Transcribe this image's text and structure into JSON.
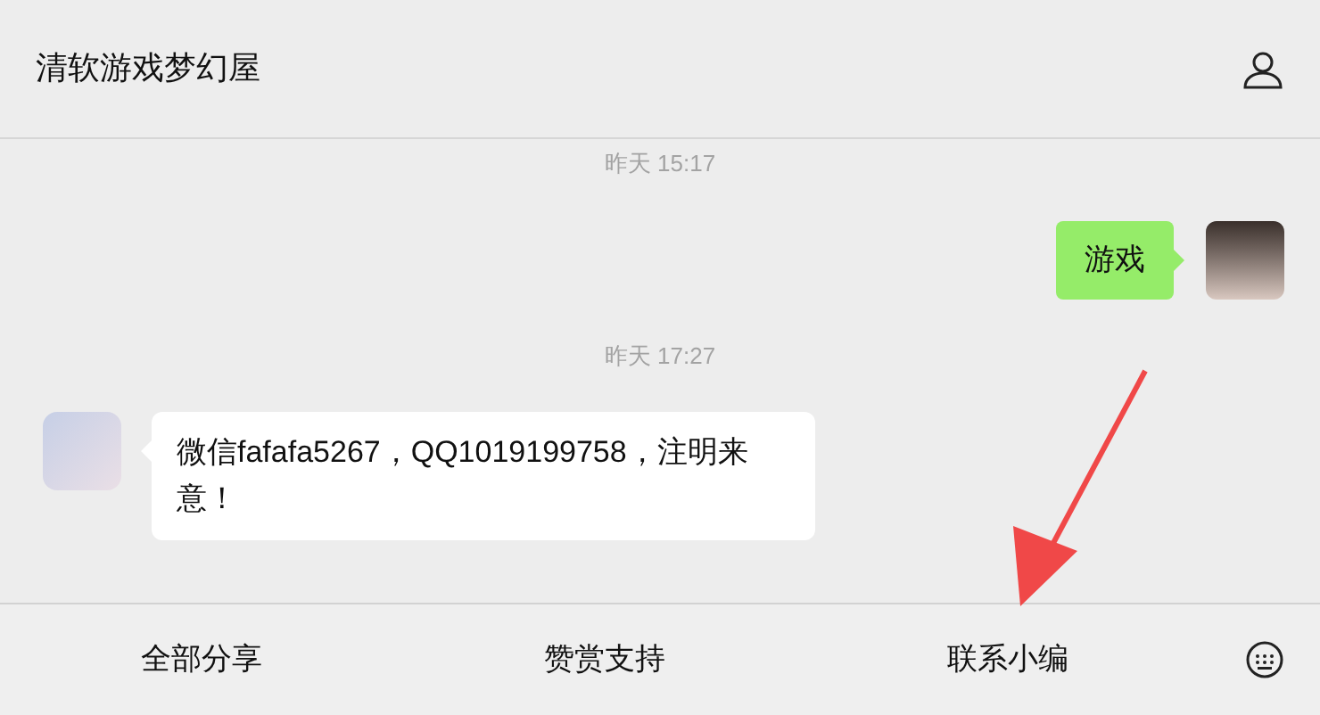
{
  "header": {
    "title": "清软游戏梦幻屋"
  },
  "messages": [
    {
      "kind": "time",
      "text": "昨天 15:17"
    },
    {
      "kind": "sent",
      "text": "游戏"
    },
    {
      "kind": "time",
      "text": "昨天 17:27"
    },
    {
      "kind": "received",
      "text": "微信fafafa5267，QQ1019199758，注明来意！"
    }
  ],
  "menu": [
    {
      "label": "全部分享"
    },
    {
      "label": "赞赏支持"
    },
    {
      "label": "联系小编"
    }
  ]
}
